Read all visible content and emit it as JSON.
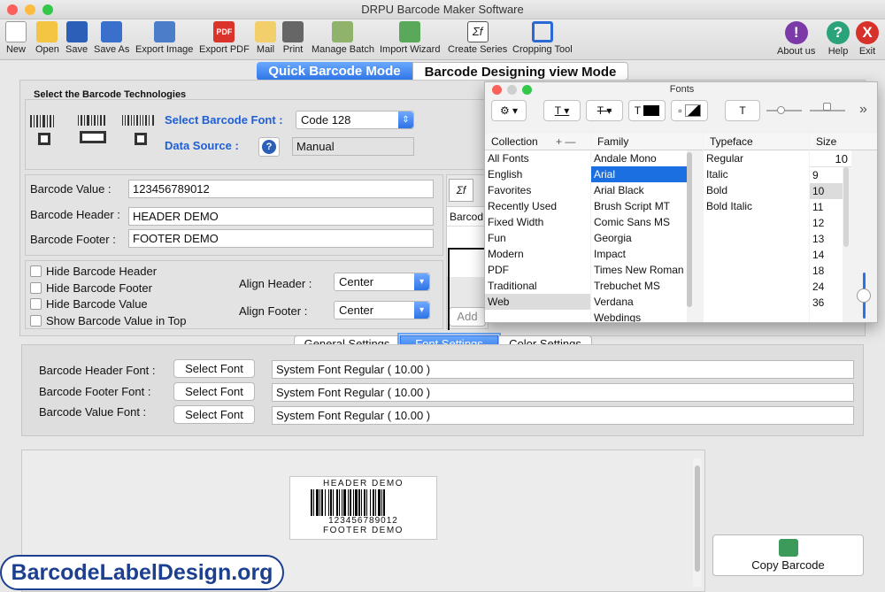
{
  "window": {
    "title": "DRPU Barcode Maker Software"
  },
  "toolbar": {
    "new": "New",
    "open": "Open",
    "save": "Save",
    "save_as": "Save As",
    "export_image": "Export Image",
    "export_pdf": "Export PDF",
    "mail": "Mail",
    "print": "Print",
    "manage_batch": "Manage Batch",
    "import_wizard": "Import Wizard",
    "create_series": "Create Series",
    "cropping_tool": "Cropping Tool",
    "about": "About us",
    "help": "Help",
    "exit": "Exit",
    "pdf_glyph": "PDF",
    "series_glyph": "Σf"
  },
  "modes": {
    "quick": "Quick Barcode Mode",
    "designing": "Barcode Designing view Mode"
  },
  "technologies": {
    "title": "Select the Barcode Technologies",
    "font_label": "Select Barcode Font :",
    "font_value": "Code 128",
    "source_label": "Data Source :",
    "source_value": "Manual"
  },
  "values": {
    "value_label": "Barcode Value :",
    "value": "123456789012",
    "header_label": "Barcode Header :",
    "header": "HEADER DEMO",
    "footer_label": "Barcode Footer :",
    "footer": "FOOTER DEMO"
  },
  "options": {
    "hide_header": "Hide Barcode Header",
    "hide_footer": "Hide Barcode Footer",
    "hide_value": "Hide Barcode Value",
    "show_top": "Show Barcode Value in Top",
    "align_header_label": "Align Header :",
    "align_header": "Center",
    "align_footer_label": "Align Footer :",
    "align_footer": "Center"
  },
  "series_partial": {
    "glyph": "Σf",
    "col": "Barcod",
    "add": "Add"
  },
  "tabs": {
    "general": "General Settings",
    "font": "Font Settings",
    "color": "Color Settings"
  },
  "font_settings": {
    "header_label": "Barcode Header Font :",
    "footer_label": "Barcode Footer Font :",
    "value_label": "Barcode Value Font :",
    "select_button": "Select Font",
    "header_font": "System Font Regular ( 10.00 )",
    "footer_font": "System Font Regular ( 10.00 )",
    "value_font": "System Font Regular ( 10.00 )"
  },
  "preview": {
    "header": "HEADER DEMO",
    "value": "123456789012",
    "footer": "FOOTER DEMO"
  },
  "copy_button": "Copy Barcode",
  "brand": "BarcodeLabelDesign.org",
  "fonts_panel": {
    "title": "Fonts",
    "t_glyph": "T",
    "more": "»",
    "headers": {
      "collection": "Collection",
      "family": "Family",
      "typeface": "Typeface",
      "size": "Size",
      "plus_minus": "+ —"
    },
    "collections": [
      "All Fonts",
      "English",
      "Favorites",
      "Recently Used",
      "Fixed Width",
      "Fun",
      "Modern",
      "PDF",
      "Traditional",
      "Web"
    ],
    "families": [
      "Andale Mono",
      "Arial",
      "Arial Black",
      "Brush Script MT",
      "Comic Sans MS",
      "Georgia",
      "Impact",
      "Times New Roman",
      "Trebuchet MS",
      "Verdana",
      "Webdings"
    ],
    "typefaces": [
      "Regular",
      "Italic",
      "Bold",
      "Bold Italic"
    ],
    "size_value": "10",
    "sizes": [
      "9",
      "10",
      "11",
      "12",
      "13",
      "14",
      "18",
      "24",
      "36"
    ]
  },
  "colors": {
    "accent": "#1b6fe0",
    "brand": "#1c3f8f",
    "close": "#fc605b",
    "min": "#fdbc40",
    "max": "#34c84a"
  }
}
